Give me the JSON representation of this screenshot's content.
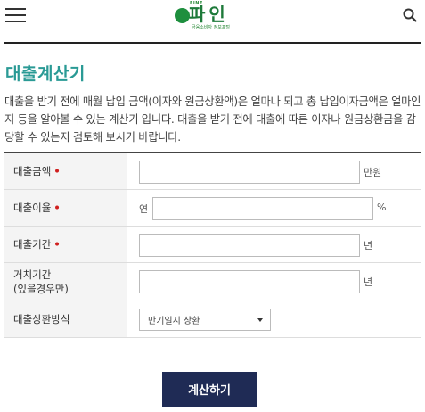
{
  "header": {
    "logo_top": "FINE",
    "logo_main": "파인",
    "logo_sub": "금융소비자 정보포털"
  },
  "page": {
    "title": "대출계산기",
    "description": "대출을 받기 전에 매월 납입 금액(이자와 원금상환액)은 얼마나 되고 총 납입이자금액은 얼마인지 등을 알아볼 수 있는 계산기 입니다. 대출을 받기 전에 대출에 따른 이자나 원금상환금을 감당할 수 있는지 검토해 보시기 바랍니다."
  },
  "form": {
    "amount": {
      "label": "대출금액",
      "required": "•",
      "value": "",
      "unit": "만원"
    },
    "rate": {
      "label": "대출이율",
      "required": "•",
      "prefix": "연",
      "value": "",
      "unit": "%"
    },
    "period": {
      "label": "대출기간",
      "required": "•",
      "value": "",
      "unit": "년"
    },
    "grace": {
      "label_line1": "거치기간",
      "label_line2": "(있을경우만)",
      "value": "",
      "unit": "년"
    },
    "method": {
      "label": "대출상환방식",
      "selected": "만기일시 상환"
    }
  },
  "actions": {
    "calculate_label": "계산하기"
  },
  "colors": {
    "title": "#2a9a95",
    "button": "#1f2b55",
    "required": "#d0201f",
    "logo": "#1e7a3a"
  }
}
